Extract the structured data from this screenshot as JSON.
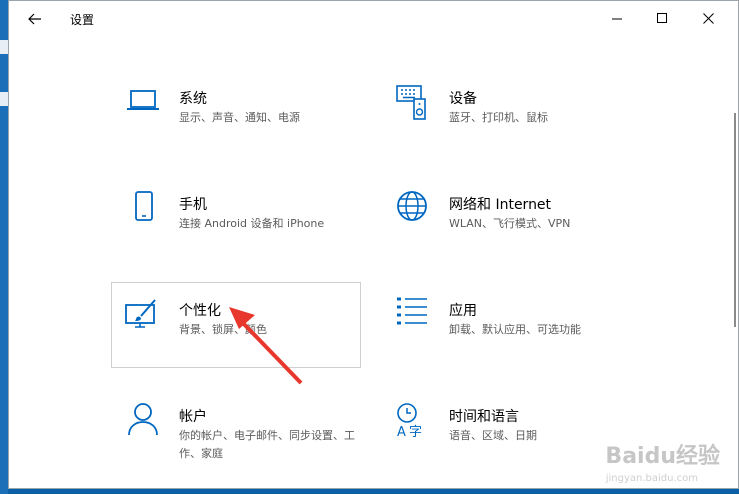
{
  "window": {
    "title": "设置"
  },
  "colors": {
    "accent": "#0067c0",
    "arrow": "#e8372c"
  },
  "tiles": [
    {
      "name": "系统",
      "desc": "显示、声音、通知、电源",
      "icon": "laptop-icon"
    },
    {
      "name": "设备",
      "desc": "蓝牙、打印机、鼠标",
      "icon": "keyboard-speaker-icon"
    },
    {
      "name": "手机",
      "desc": "连接 Android 设备和 iPhone",
      "icon": "phone-icon"
    },
    {
      "name": "网络和 Internet",
      "desc": "WLAN、飞行模式、VPN",
      "icon": "globe-icon"
    },
    {
      "name": "个性化",
      "desc": "背景、锁屏、颜色",
      "icon": "paint-monitor-icon"
    },
    {
      "name": "应用",
      "desc": "卸载、默认应用、可选功能",
      "icon": "app-list-icon"
    },
    {
      "name": "帐户",
      "desc": "你的帐户、电子邮件、同步设置、工作、家庭",
      "icon": "person-icon"
    },
    {
      "name": "时间和语言",
      "desc": "语音、区域、日期",
      "icon": "time-language-icon"
    }
  ],
  "watermark": {
    "brand": "Baidu经验",
    "url": "jingyan.baidu.com"
  }
}
